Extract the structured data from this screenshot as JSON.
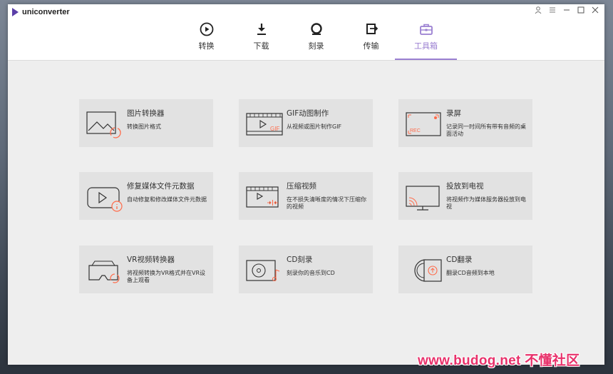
{
  "app": {
    "name": "uniconverter"
  },
  "nav": [
    {
      "label": "转换"
    },
    {
      "label": "下载"
    },
    {
      "label": "刻录"
    },
    {
      "label": "传输"
    },
    {
      "label": "工具箱"
    }
  ],
  "tools": [
    {
      "title": "图片转换器",
      "desc": "转换图片格式"
    },
    {
      "title": "GIF动图制作",
      "desc": "从视频或图片制作GIF"
    },
    {
      "title": "录屏",
      "desc": "记录同一时间所有带有音频的桌面活动"
    },
    {
      "title": "修复媒体文件元数据",
      "desc": "自动修复和修改媒体文件元数据"
    },
    {
      "title": "压缩视频",
      "desc": "在不损失清晰度的情况下压缩你的视频"
    },
    {
      "title": "投放到电视",
      "desc": "将视频作为媒体服务器投放到电视"
    },
    {
      "title": "VR视频转换器",
      "desc": "将视频转换为VR格式并在VR设备上观看"
    },
    {
      "title": "CD刻录",
      "desc": "刻录你的音乐到CD"
    },
    {
      "title": "CD翻录",
      "desc": "翻录CD音频到本地"
    }
  ],
  "icon_text": {
    "gif": "GIF",
    "rec": "REC"
  },
  "watermark": "www.budog.net 不懂社区",
  "colors": {
    "accent": "#9a7fd1",
    "orange": "#ff6b4a",
    "brand": "#5b3fa8"
  }
}
